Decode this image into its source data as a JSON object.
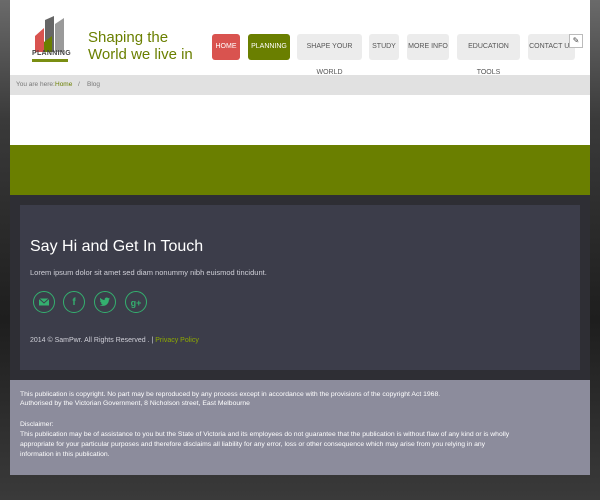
{
  "header": {
    "logo_text": "PLANNING",
    "tagline_line1": "Shaping the",
    "tagline_line2": "World we live in"
  },
  "nav": {
    "items": [
      {
        "label": "HOME"
      },
      {
        "label": "PLANNING"
      },
      {
        "label": "SHAPE YOUR WORLD"
      },
      {
        "label": "STUDY"
      },
      {
        "label": "MORE INFO"
      },
      {
        "label": "EDUCATION TOOLS"
      },
      {
        "label": "CONTACT US"
      }
    ],
    "active_label": "PLANNING",
    "home_color": "#d9534f",
    "active_color": "#6a7f00"
  },
  "breadcrumb": {
    "prefix": "You are here:",
    "home": "Home",
    "separator": "/",
    "current": "Blog"
  },
  "footer": {
    "title": "Say Hi and Get In Touch",
    "text": "Lorem ipsum dolor sit amet sed diam nonummy nibh euismod tincidunt.",
    "social": [
      "email-icon",
      "facebook-icon",
      "twitter-icon",
      "google-plus-icon"
    ],
    "copyright": "2014 © SamPwr. All Rights Reserved . |",
    "policy_link": "Privacy Policy"
  },
  "disclaimer": {
    "line1": "This publication is copyright. No part may be reproduced by any process except in accordance with the provisions of the copyright Act 1968.",
    "line2": "Authorised by the Victorian Government, 8 Nicholson street, East Melbourne",
    "heading": "Disclaimer:",
    "line3": "This publication may be of assistance to you but the State of Victoria and its employees do not guarantee that the publication is without flaw of any kind or is wholly",
    "line4": "appropriate for your particular purposes and therefore disclaims all liability for any error, loss or other consequence which may arise from you relying in any",
    "line5": "information in this publication."
  },
  "colors": {
    "brand_green": "#6a7f00",
    "social_green": "#34b06f"
  }
}
